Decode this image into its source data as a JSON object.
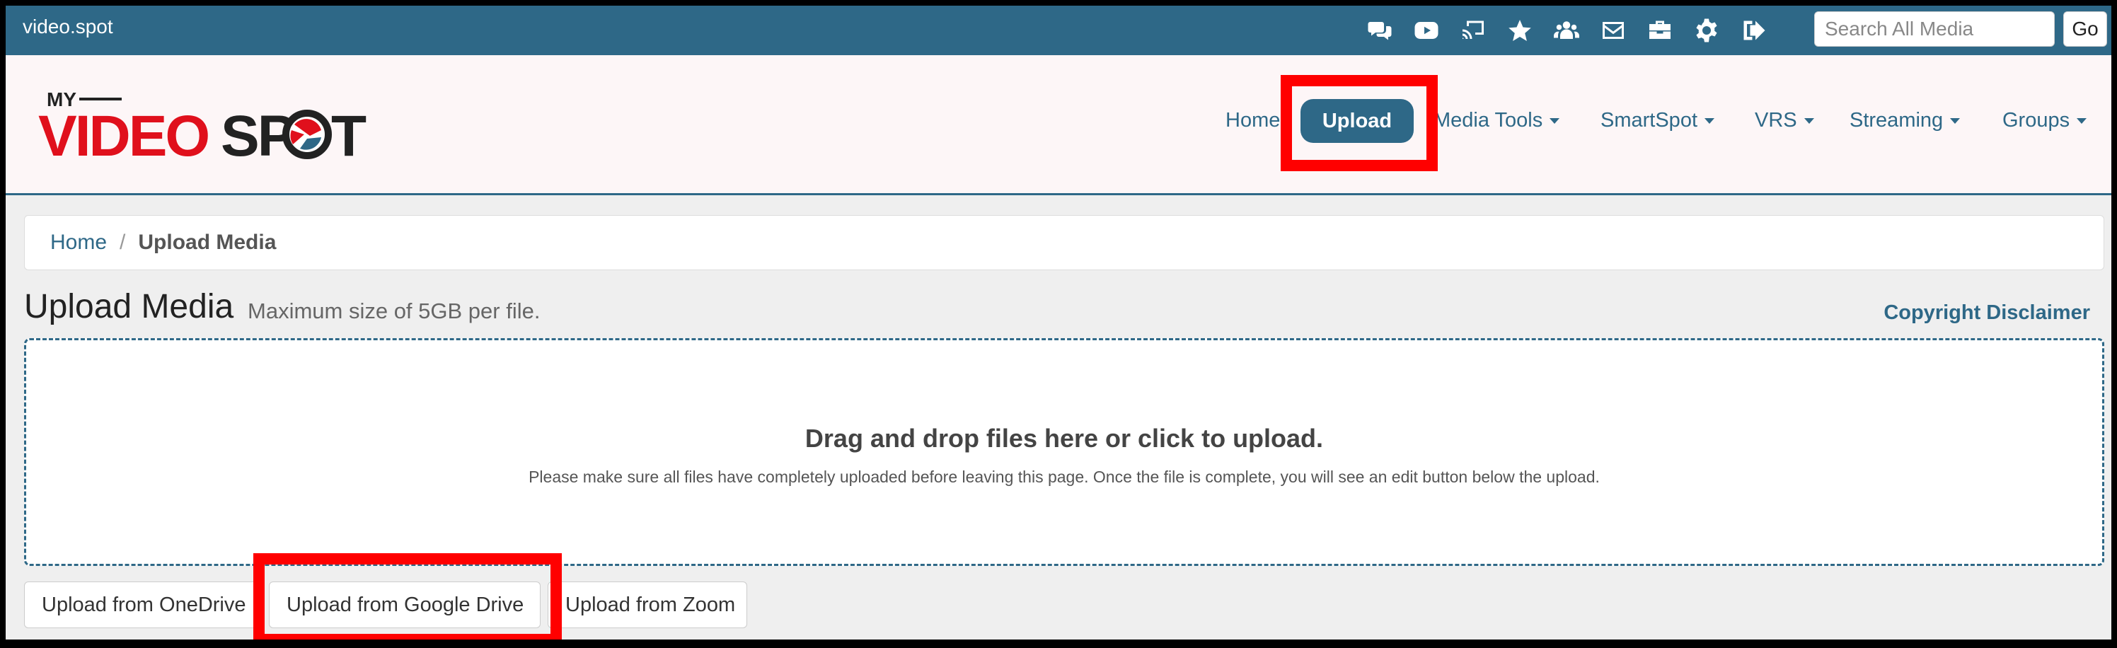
{
  "topbar": {
    "site_name": "video.spot",
    "icons": [
      "chat-icon",
      "youtube-icon",
      "cast-icon",
      "star-icon",
      "users-icon",
      "mail-icon",
      "toolbox-icon",
      "gear-icon",
      "sign-out-icon"
    ],
    "search_placeholder": "Search All Media",
    "go_label": "Go",
    "bg_color": "#2e6887"
  },
  "header": {
    "logo_text_top": "MY",
    "logo_text_red": "VIDEO",
    "logo_text_dark": "SP",
    "logo_text_dark2": "T",
    "nav": {
      "home": "Home",
      "upload": "Upload",
      "media_tools": "Media Tools",
      "smartspot": "SmartSpot",
      "vrs": "VRS",
      "streaming": "Streaming",
      "groups": "Groups"
    }
  },
  "breadcrumb": {
    "home": "Home",
    "separator": "/",
    "current": "Upload Media"
  },
  "main": {
    "title": "Upload Media",
    "subtitle": "Maximum size of 5GB per file.",
    "copyright": "Copyright Disclaimer",
    "dropzone_title": "Drag and drop files here or click to upload.",
    "dropzone_note": "Please make sure all files have completely uploaded before leaving this page. Once the file is complete, you will see an edit button below the upload.",
    "sources": {
      "onedrive": "Upload from OneDrive",
      "google_drive": "Upload from Google Drive",
      "zoom": "Upload from Zoom"
    }
  },
  "colors": {
    "accent": "#2e6887",
    "logo_red": "#e0101c",
    "logo_dark": "#222222",
    "highlight": "#ff0000"
  }
}
